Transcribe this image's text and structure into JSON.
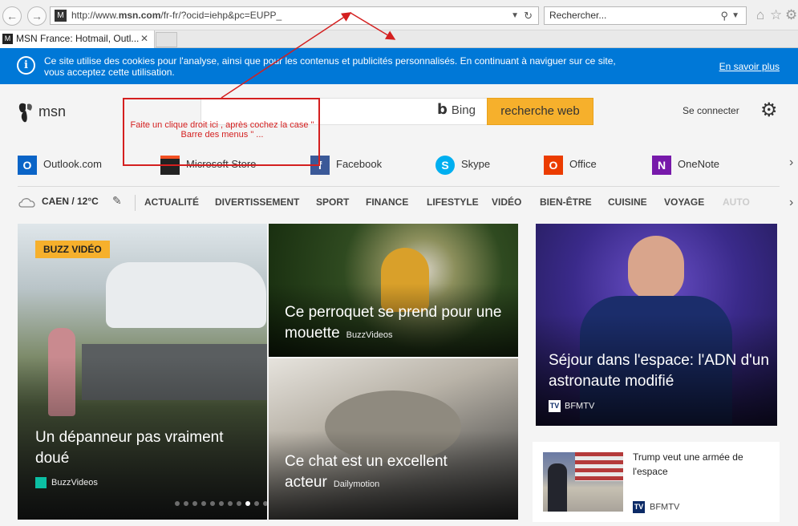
{
  "browser": {
    "url_prefix": "http://www.",
    "url_host": "msn.com",
    "url_path": "/fr-fr/?ocid=iehp&pc=EUPP_",
    "search_placeholder": "Rechercher...",
    "tab_title": "MSN France: Hotmail, Outl..."
  },
  "cookie_banner": {
    "text": "Ce site utilise des cookies pour l'analyse, ainsi que pour les contenus et publicités personnalisés. En continuant à naviguer sur ce site, vous acceptez cette utilisation.",
    "link": "En savoir plus",
    "color": "#0078d7"
  },
  "header": {
    "logo": "msn",
    "bing_label": "Bing",
    "search_button": "recherche web",
    "signin": "Se connecter",
    "accent": "#f6b02c"
  },
  "quick_links": [
    {
      "label": "Outlook.com",
      "icon": "outlook-icon"
    },
    {
      "label": "Microsoft Store",
      "icon": "store-icon"
    },
    {
      "label": "Facebook",
      "icon": "facebook-icon"
    },
    {
      "label": "Skype",
      "icon": "skype-icon"
    },
    {
      "label": "Office",
      "icon": "office-icon"
    },
    {
      "label": "OneNote",
      "icon": "onenote-icon"
    }
  ],
  "weather": "CAEN / 12°C",
  "categories": [
    "ACTUALITÉ",
    "DIVERTISSEMENT",
    "SPORT",
    "FINANCE",
    "LIFESTYLE",
    "VIDÉO",
    "BIEN-ÊTRE",
    "CUISINE",
    "VOYAGE",
    "AUTO"
  ],
  "cards": {
    "main": {
      "badge": "BUZZ VIDÉO",
      "title": "Un dépanneur pas vraiment doué",
      "source": "BuzzVideos"
    },
    "top": {
      "title": "Ce perroquet se prend pour une mouette",
      "source": "BuzzVideos"
    },
    "bottom": {
      "title": "Ce chat est un excellent acteur",
      "source": "Dailymotion"
    },
    "right": {
      "title": "Séjour dans l'espace: l'ADN d'un astronaute modifié",
      "source": "BFMTV"
    },
    "side": {
      "title": "Trump veut une armée de l'espace",
      "source": "BFMTV"
    }
  },
  "carousel": {
    "count": 20,
    "active": 8
  },
  "annotation": {
    "text": "Faite un clique droit ici , après cochez la case \" Barre des menus \" ...",
    "color": "#d41f1f"
  }
}
